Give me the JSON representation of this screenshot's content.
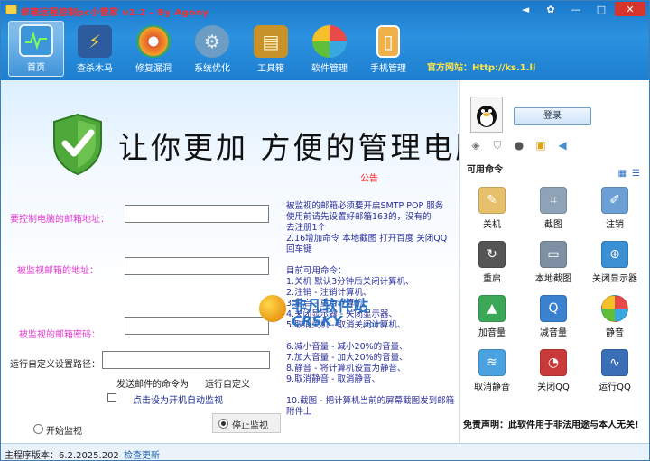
{
  "window": {
    "title": "邮箱远程控制pc小管家 v2.2 - By Agony",
    "official_site": "官方网站：Http://ks.1.li"
  },
  "toolbar": {
    "items": [
      {
        "label": "首页",
        "icon": "home-monitor-icon",
        "color": "#2b8fd8"
      },
      {
        "label": "查杀木马",
        "icon": "shield-bolt-icon",
        "color": "#2c5c9e"
      },
      {
        "label": "修复漏洞",
        "icon": "ie-globe-icon",
        "color": "#e25c2b"
      },
      {
        "label": "系统优化",
        "icon": "gear-icon",
        "color": "#5b8fb8"
      },
      {
        "label": "工具箱",
        "icon": "toolbox-icon",
        "color": "#c8922a"
      },
      {
        "label": "软件管理",
        "icon": "flower-icon",
        "color": "#5fbf3a"
      },
      {
        "label": "手机管理",
        "icon": "phone-icon",
        "color": "#e8a23b"
      }
    ]
  },
  "main": {
    "headline": "让你更加 方便的管理电脑 ！",
    "notice_link": "公告",
    "form": {
      "control_email_label": "要控制电脑的邮箱地址：",
      "control_email_value": "",
      "monitored_email_label": "被监视邮箱的地址：",
      "monitored_email_value": "",
      "monitored_password_label": "被监视的邮箱密码：",
      "monitored_password_value": "",
      "custom_path_label": "运行自定义设置路径：",
      "custom_path_value": "",
      "send_command_label": "发送邮件的命令为",
      "run_custom_label": "运行自定义",
      "autostart_label": "点击设为开机自动监视",
      "start_label": "开始监视",
      "stop_label": "停止监视"
    },
    "notes": "被监视的邮箱必须要开启SMTP  POP 服务\n使用前请先设置好邮箱163的，没有的\n去注册1个\n2.16增加命令 本地截图 打开百度 关闭QQ  回车键\n\n目前可用命令：\n 1.关机 默认3分钟后关闭计算机、\n 2.注销 - 注销计算机、\n 3.重启 - 重启计算机、\n 4.关闭显示器 - 关闭显示器、\n 5.取消关机 - 取消关闭计算机、\n\n 6.减小音量 - 减小20%的音量、\n 7.加大音量 - 加大20%的音量、\n 8.静音 - 将计算机设置为静音、\n 9.取消静音 - 取消静音、\n\n 10.截图 - 把计算机当前的屏幕截图发到邮箱附件上"
  },
  "side": {
    "login_label": "登录",
    "commands_title": "可用命令",
    "commands": [
      {
        "label": "关机",
        "icon": "broom-icon",
        "color": "#d9a53a"
      },
      {
        "label": "截图",
        "icon": "screenshot-icon",
        "color": "#7a8ea5"
      },
      {
        "label": "注销",
        "icon": "pen-icon",
        "color": "#5a8ec6"
      },
      {
        "label": "重启",
        "icon": "restart-icon",
        "color": "#444"
      },
      {
        "label": "本地截图",
        "icon": "monitor-icon",
        "color": "#6a7d92"
      },
      {
        "label": "关闭显示器",
        "icon": "network-icon",
        "color": "#3b8fd3"
      },
      {
        "label": "加音量",
        "icon": "volume-up-icon",
        "color": "#3aa856"
      },
      {
        "label": "减音量",
        "icon": "q-icon",
        "color": "#3a82d0"
      },
      {
        "label": "静音",
        "icon": "flower-mute-icon",
        "color": "#e66f3a"
      },
      {
        "label": "取消静音",
        "icon": "wifi-router-icon",
        "color": "#4aa2e0"
      },
      {
        "label": "关闭QQ",
        "icon": "speedometer-icon",
        "color": "#c83a3a"
      },
      {
        "label": "运行QQ",
        "icon": "chart-line-icon",
        "color": "#3a6fb8"
      }
    ],
    "disclaimer": "免责声明：此软件用于非法用途与本人无关!"
  },
  "status": {
    "version": "主程序版本：6.2.2025.202",
    "check_update": "检查更新"
  },
  "watermark": {
    "cn": "非凡软件站",
    "en": "CRSKY",
    "com": ".com"
  }
}
